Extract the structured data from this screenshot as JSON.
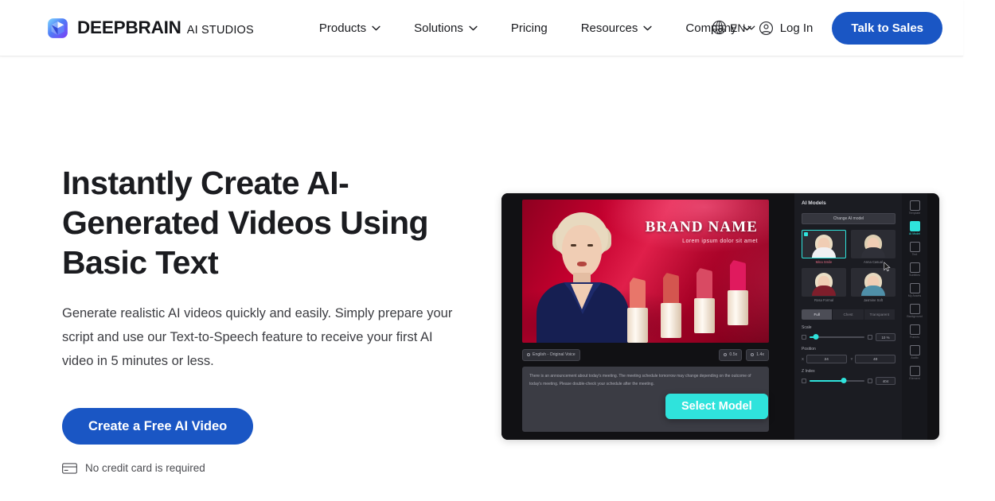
{
  "brand": {
    "name": "DEEPBRAIN",
    "sub": "AI STUDIOS",
    "logo_icon": "cube-logo-icon",
    "logo_color": "#3f5bf6"
  },
  "nav": {
    "items": [
      {
        "label": "Products",
        "has_dropdown": true,
        "icon": "chevron-down-icon"
      },
      {
        "label": "Solutions",
        "has_dropdown": true,
        "icon": "chevron-down-icon"
      },
      {
        "label": "Pricing",
        "has_dropdown": false,
        "icon": ""
      },
      {
        "label": "Resources",
        "has_dropdown": true,
        "icon": "chevron-down-icon"
      },
      {
        "label": "Company",
        "has_dropdown": true,
        "icon": "chevron-down-icon"
      }
    ]
  },
  "language_selector": {
    "label": "EN",
    "globe_icon": "globe-icon",
    "chevron_icon": "chevron-down-icon"
  },
  "header_actions": {
    "login_label": "Log In",
    "login_icon": "user-circle-icon",
    "sales_label": "Talk to Sales",
    "sales_color": "#1a56c4"
  },
  "hero": {
    "title": "Instantly Create AI-Generated Videos Using Basic Text",
    "description": "Generate realistic AI videos quickly and easily. Simply prepare your script and use our Text-to-Speech feature to receive your first AI video in 5 minutes or less.",
    "cta_label": "Create a Free AI Video",
    "cta_color": "#1a56c4",
    "note": "No credit card is required",
    "note_icon": "credit-card-icon"
  },
  "mockup": {
    "stage": {
      "brand_name": "BRAND NAME",
      "brand_tagline": "Lorem ipsum dolor sit amet"
    },
    "controls": {
      "voice_chip": "English - Original Voice",
      "voice_icon": "voice-icon",
      "speed_chip": "0.5x",
      "pitch_chip": "1.4x",
      "speed_icon": "clock-icon",
      "pitch_icon": "clock-icon"
    },
    "script_text": "There is an announcement about today's meeting. The meeting schedule tomorrow may change depending on the outcome of today's meeting. Please double-check your schedule after the meeting.",
    "select_model_button": {
      "label": "Select Model",
      "color": "#2fe3dc"
    },
    "panel": {
      "title": "AI Models",
      "change_model_label": "Change AI model",
      "models": [
        {
          "label": "Mina Smile",
          "selected": true,
          "hair": "#e9dcc2",
          "body": "#f0f0f2"
        },
        {
          "label": "Anna Casual",
          "selected": false,
          "hair": "#ded0b3",
          "body": "#2f3038"
        },
        {
          "label": "Rosa Formal",
          "selected": false,
          "hair": "#eadfc6",
          "body": "#7e1e2b"
        },
        {
          "label": "Jasmine Soft",
          "selected": false,
          "hair": "#e6d9bf",
          "body": "#4f8fa8"
        }
      ],
      "tabs": [
        {
          "label": "Full",
          "active": true
        },
        {
          "label": "Chest",
          "active": false
        },
        {
          "label": "Transparent",
          "active": false
        }
      ],
      "scale": {
        "label": "Scale",
        "value": "10 %",
        "fill_pct": 12
      },
      "position": {
        "label": "Position",
        "x_axis": "X",
        "x_value": "24",
        "y_axis": "Y",
        "y_value": "40"
      },
      "zindex": {
        "label": "Z Index",
        "value": "404",
        "fill_pct": 62
      }
    },
    "rail": [
      {
        "label": "Template",
        "icon": "template-icon",
        "active": false
      },
      {
        "label": "AI Model",
        "icon": "ai-model-icon",
        "active": true
      },
      {
        "label": "Text",
        "icon": "text-icon",
        "active": false
      },
      {
        "label": "Subtitles",
        "icon": "subtitles-icon",
        "active": false
      },
      {
        "label": "My Assets",
        "icon": "assets-icon",
        "active": false
      },
      {
        "label": "Background",
        "icon": "background-icon",
        "active": false
      },
      {
        "label": "Frames",
        "icon": "frames-icon",
        "active": false
      },
      {
        "label": "Audio",
        "icon": "audio-icon",
        "active": false
      },
      {
        "label": "Element",
        "icon": "element-icon",
        "active": false
      }
    ],
    "cursor_icon": "mouse-pointer-icon"
  }
}
